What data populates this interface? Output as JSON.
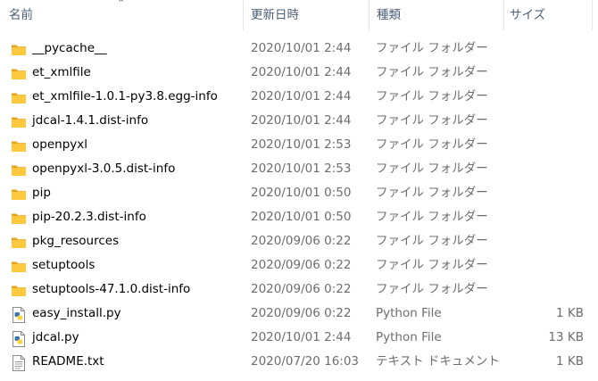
{
  "header": {
    "name": "名前",
    "date": "更新日時",
    "type": "種類",
    "size": "サイズ",
    "sort_icon": "chevron-up-icon"
  },
  "colors": {
    "folder": "#FFC83D",
    "folder_dark": "#E8A317",
    "header_text": "#4C607A",
    "detail_text": "#6D6D6D"
  },
  "files": [
    {
      "name": "__pycache__",
      "date": "2020/10/01 2:44",
      "type": "ファイル フォルダー",
      "size": "",
      "icon": "folder-icon"
    },
    {
      "name": "et_xmlfile",
      "date": "2020/10/01 2:44",
      "type": "ファイル フォルダー",
      "size": "",
      "icon": "folder-icon"
    },
    {
      "name": "et_xmlfile-1.0.1-py3.8.egg-info",
      "date": "2020/10/01 2:44",
      "type": "ファイル フォルダー",
      "size": "",
      "icon": "folder-icon"
    },
    {
      "name": "jdcal-1.4.1.dist-info",
      "date": "2020/10/01 2:44",
      "type": "ファイル フォルダー",
      "size": "",
      "icon": "folder-icon"
    },
    {
      "name": "openpyxl",
      "date": "2020/10/01 2:53",
      "type": "ファイル フォルダー",
      "size": "",
      "icon": "folder-icon"
    },
    {
      "name": "openpyxl-3.0.5.dist-info",
      "date": "2020/10/01 2:53",
      "type": "ファイル フォルダー",
      "size": "",
      "icon": "folder-icon"
    },
    {
      "name": "pip",
      "date": "2020/10/01 0:50",
      "type": "ファイル フォルダー",
      "size": "",
      "icon": "folder-icon"
    },
    {
      "name": "pip-20.2.3.dist-info",
      "date": "2020/10/01 0:50",
      "type": "ファイル フォルダー",
      "size": "",
      "icon": "folder-icon"
    },
    {
      "name": "pkg_resources",
      "date": "2020/09/06 0:22",
      "type": "ファイル フォルダー",
      "size": "",
      "icon": "folder-icon"
    },
    {
      "name": "setuptools",
      "date": "2020/09/06 0:22",
      "type": "ファイル フォルダー",
      "size": "",
      "icon": "folder-icon"
    },
    {
      "name": "setuptools-47.1.0.dist-info",
      "date": "2020/09/06 0:22",
      "type": "ファイル フォルダー",
      "size": "",
      "icon": "folder-icon"
    },
    {
      "name": "easy_install.py",
      "date": "2020/09/06 0:22",
      "type": "Python File",
      "size": "1 KB",
      "icon": "python-file-icon"
    },
    {
      "name": "jdcal.py",
      "date": "2020/10/01 2:44",
      "type": "Python File",
      "size": "13 KB",
      "icon": "python-file-icon"
    },
    {
      "name": "README.txt",
      "date": "2020/07/20 16:03",
      "type": "テキスト ドキュメント",
      "size": "1 KB",
      "icon": "text-file-icon"
    }
  ]
}
